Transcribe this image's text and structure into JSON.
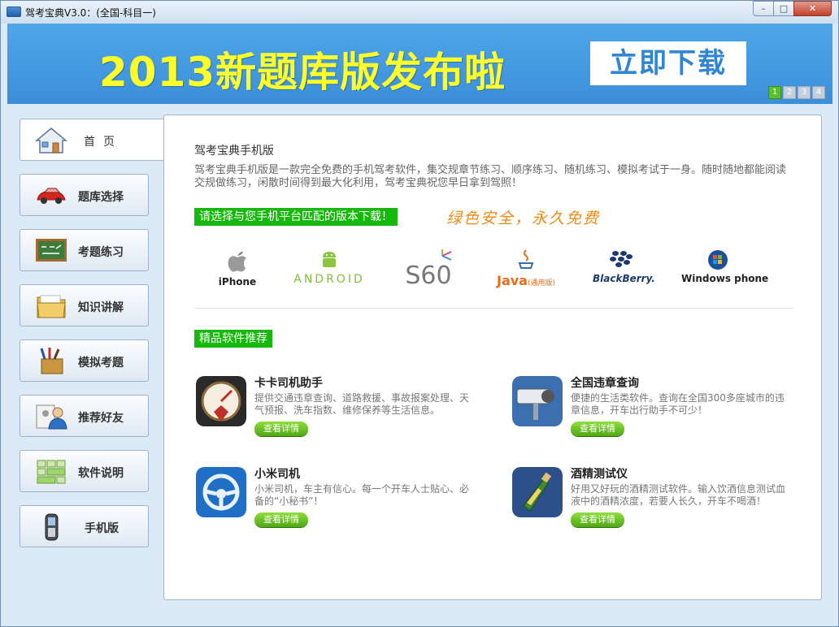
{
  "window": {
    "title": "驾考宝典V3.0：(全国-科目一)",
    "controls": {
      "minimize": "–",
      "maximize": "□",
      "close": "✕"
    }
  },
  "banner": {
    "headline": "2013新题库版发布啦",
    "download_label": "立即下载",
    "pages": [
      "1",
      "2",
      "3",
      "4"
    ],
    "active_page": "1",
    "colors": {
      "background": "#3b8fd9",
      "headline": "#ffff2a"
    }
  },
  "sidebar": {
    "items": [
      {
        "label": "首页",
        "icon": "house-icon",
        "active": true
      },
      {
        "label": "题库选择",
        "icon": "red-car-icon"
      },
      {
        "label": "考题练习",
        "icon": "chalkboard-icon"
      },
      {
        "label": "知识讲解",
        "icon": "folder-icon"
      },
      {
        "label": "模拟考题",
        "icon": "stationery-icon"
      },
      {
        "label": "推荐好友",
        "icon": "contact-user-icon"
      },
      {
        "label": "软件说明",
        "icon": "grid-blocks-icon"
      },
      {
        "label": "手机版",
        "icon": "mobile-phone-icon"
      }
    ]
  },
  "main": {
    "app_title": "驾考宝典手机版",
    "app_desc": "驾考宝典手机版是一款完全免费的手机驾考软件，集交规章节练习、顺序练习、随机练习、模拟考试于一身。随时随地都能阅读交规做练习，闲散时间得到最大化利用，驾考宝典祝您早日拿到驾照！",
    "platform_prompt": "请选择与您手机平台匹配的版本下载！",
    "slogan": "绿色安全，永久免费",
    "platforms": [
      {
        "label": "iPhone",
        "icon": "apple-icon"
      },
      {
        "label": "ANDROID",
        "icon": "android-icon"
      },
      {
        "label": "S60",
        "icon": "s60-icon"
      },
      {
        "label": "Java",
        "sub": "(通用版)",
        "icon": "java-cup-icon"
      },
      {
        "label": "BlackBerry.",
        "icon": "blackberry-icon"
      },
      {
        "label": "Windows phone",
        "icon": "windows-flag-icon"
      }
    ],
    "recommend_title": "精品软件推荐",
    "detail_label": "查看详情",
    "recommendations": [
      {
        "name": "卡卡司机助手",
        "desc": "提供交通违章查询、道路救援、事故报案处理、天气预报、洗车指数、维修保养等生活信息。",
        "icon": "gauge-icon"
      },
      {
        "name": "全国违章查询",
        "desc": "便捷的生活类软件。查询在全国300多座城市的违章信息，开车出行助手不可少！",
        "icon": "traffic-camera-icon"
      },
      {
        "name": "小米司机",
        "desc": "小米司机，车主有信心。每一个开车人士贴心、必备的“小秘书”！",
        "icon": "steering-wheel-icon"
      },
      {
        "name": "酒精测试仪",
        "desc": "好用又好玩的酒精测试软件。输入饮酒信息测试血液中的酒精浓度，若要人长久，开车不喝酒！",
        "icon": "wine-bottle-icon"
      }
    ]
  }
}
